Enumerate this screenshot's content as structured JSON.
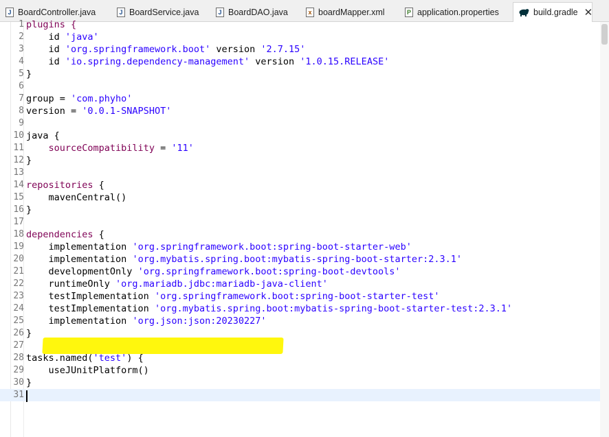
{
  "tabs": [
    {
      "label": "BoardController.java",
      "icon": "java-file-icon",
      "glyph": "J"
    },
    {
      "label": "BoardService.java",
      "icon": "java-file-icon",
      "glyph": "J"
    },
    {
      "label": "BoardDAO.java",
      "icon": "java-file-icon",
      "glyph": "J"
    },
    {
      "label": "boardMapper.xml",
      "icon": "xml-file-icon",
      "glyph": "x"
    },
    {
      "label": "application.properties",
      "icon": "properties-file-icon",
      "glyph": "P"
    },
    {
      "label": "build.gradle",
      "icon": "gradle-elephant-icon",
      "glyph": "",
      "active": true,
      "close": "✕"
    }
  ],
  "editor": {
    "colors": {
      "string": "#2a00ff",
      "keyword": "#7f0055",
      "highlight": "#fff700",
      "current_line": "#e8f2fe"
    },
    "current_line": 31,
    "highlighted_line": 25,
    "lines": [
      {
        "n": "1",
        "parts": [
          {
            "t": "plugins {",
            "c": "kw"
          }
        ]
      },
      {
        "n": "2",
        "parts": [
          {
            "t": "    id "
          },
          {
            "t": "'java'",
            "c": "str"
          }
        ]
      },
      {
        "n": "3",
        "parts": [
          {
            "t": "    id "
          },
          {
            "t": "'org.springframework.boot'",
            "c": "str"
          },
          {
            "t": " version "
          },
          {
            "t": "'2.7.15'",
            "c": "str"
          }
        ]
      },
      {
        "n": "4",
        "parts": [
          {
            "t": "    id "
          },
          {
            "t": "'io.spring.dependency-management'",
            "c": "str"
          },
          {
            "t": " version "
          },
          {
            "t": "'1.0.15.RELEASE'",
            "c": "str"
          }
        ]
      },
      {
        "n": "5",
        "parts": [
          {
            "t": "}"
          }
        ]
      },
      {
        "n": "6",
        "parts": []
      },
      {
        "n": "7",
        "parts": [
          {
            "t": "group = "
          },
          {
            "t": "'com.phyho'",
            "c": "str"
          }
        ]
      },
      {
        "n": "8",
        "parts": [
          {
            "t": "version = "
          },
          {
            "t": "'0.0.1-SNAPSHOT'",
            "c": "str"
          }
        ]
      },
      {
        "n": "9",
        "parts": []
      },
      {
        "n": "10",
        "parts": [
          {
            "t": "java {"
          }
        ]
      },
      {
        "n": "11",
        "parts": [
          {
            "t": "    "
          },
          {
            "t": "sourceCompatibility",
            "c": "kw"
          },
          {
            "t": " = "
          },
          {
            "t": "'11'",
            "c": "str"
          }
        ]
      },
      {
        "n": "12",
        "parts": [
          {
            "t": "}"
          }
        ]
      },
      {
        "n": "13",
        "parts": []
      },
      {
        "n": "14",
        "parts": [
          {
            "t": "repositories",
            "c": "kw"
          },
          {
            "t": " {"
          }
        ]
      },
      {
        "n": "15",
        "parts": [
          {
            "t": "    mavenCentral()"
          }
        ]
      },
      {
        "n": "16",
        "parts": [
          {
            "t": "}"
          }
        ]
      },
      {
        "n": "17",
        "parts": []
      },
      {
        "n": "18",
        "parts": [
          {
            "t": "dependencies",
            "c": "kw"
          },
          {
            "t": " {"
          }
        ]
      },
      {
        "n": "19",
        "parts": [
          {
            "t": "    implementation "
          },
          {
            "t": "'org.springframework.boot:spring-boot-starter-web'",
            "c": "str"
          }
        ]
      },
      {
        "n": "20",
        "parts": [
          {
            "t": "    implementation "
          },
          {
            "t": "'org.mybatis.spring.boot:mybatis-spring-boot-starter:2.3.1'",
            "c": "str"
          }
        ]
      },
      {
        "n": "21",
        "parts": [
          {
            "t": "    developmentOnly "
          },
          {
            "t": "'org.springframework.boot:spring-boot-devtools'",
            "c": "str"
          }
        ]
      },
      {
        "n": "22",
        "parts": [
          {
            "t": "    runtimeOnly "
          },
          {
            "t": "'org.mariadb.jdbc:mariadb-java-client'",
            "c": "str"
          }
        ]
      },
      {
        "n": "23",
        "parts": [
          {
            "t": "    testImplementation "
          },
          {
            "t": "'org.springframework.boot:spring-boot-starter-test'",
            "c": "str"
          }
        ]
      },
      {
        "n": "24",
        "parts": [
          {
            "t": "    testImplementation "
          },
          {
            "t": "'org.mybatis.spring.boot:mybatis-spring-boot-starter-test:2.3.1'",
            "c": "str"
          }
        ]
      },
      {
        "n": "25",
        "parts": [
          {
            "t": "    implementation "
          },
          {
            "t": "'org.json:json:20230227'",
            "c": "str"
          }
        ]
      },
      {
        "n": "26",
        "parts": [
          {
            "t": "}"
          }
        ]
      },
      {
        "n": "27",
        "parts": []
      },
      {
        "n": "28",
        "parts": [
          {
            "t": "tasks.named("
          },
          {
            "t": "'test'",
            "c": "str"
          },
          {
            "t": ") {"
          }
        ]
      },
      {
        "n": "29",
        "parts": [
          {
            "t": "    useJUnitPlatform()"
          }
        ]
      },
      {
        "n": "30",
        "parts": [
          {
            "t": "}"
          }
        ]
      },
      {
        "n": "31",
        "parts": []
      }
    ]
  }
}
